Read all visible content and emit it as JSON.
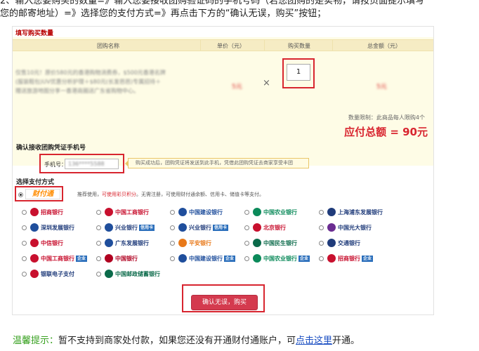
{
  "intro": {
    "line1": "2、输入您要购买的数量=》输入您要接收团购验证码的手机号码（若您团购的是实物，请按页面提示填写",
    "line2": "您的邮寄地址）=》选择您的支付方式=》再点击下方的“确认无误，购买”按钮；"
  },
  "order": {
    "section_title": "填写购买数量",
    "columns": [
      "团购名称",
      "单价（元）",
      "购买数量",
      "总金额（元）"
    ],
    "product_desc": "仅售10元！原价580元的香港购物消费券，$500元香港名牌(服装鞋包)UV优惠分析护理＋$80元(长发芭芭)专属招待＋赠送旅游地图分享一香港商圈送广东省购物中心。",
    "unit_price": "5元",
    "times_sign": "×",
    "quantity": "1",
    "line_total": "5元",
    "limit_text": "数量限制：此商品每人限购4个",
    "total_text": "应付总额 = 90元"
  },
  "phone": {
    "title": "确认接收团购凭证手机号",
    "label": "手机号：",
    "masked_value": "136****5588",
    "tip": "购买成功后，团购凭证将发送到此手机，凭借此团购凭证去商家享受丰团"
  },
  "payment": {
    "title": "选择支付方式",
    "tenpay_logo": "财付通",
    "tenpay_note_pre": "推荐使用，",
    "tenpay_note_red": "可使用彩贝积分",
    "tenpay_note_post": "。无需注册，可使用财付通余额、信用卡、储值卡等支付。",
    "banks": [
      {
        "name": "招商银行",
        "color": "#c8102e",
        "logo_color": "#c8102e",
        "badge": ""
      },
      {
        "name": "中国工商银行",
        "color": "#c8102e",
        "logo_color": "#c8102e",
        "badge": ""
      },
      {
        "name": "中国建设银行",
        "color": "#1f4e9c",
        "logo_color": "#1f4e9c",
        "badge": ""
      },
      {
        "name": "中国农业银行",
        "color": "#0b8a5a",
        "logo_color": "#0b8a5a",
        "badge": ""
      },
      {
        "name": "上海浦东发展银行",
        "color": "#1f3b7a",
        "logo_color": "#1f3b7a",
        "badge": ""
      },
      {
        "name": "深圳发展银行",
        "color": "#1f3b7a",
        "logo_color": "#1f4e9c",
        "badge": ""
      },
      {
        "name": "兴业银行",
        "color": "#1f3b7a",
        "logo_color": "#1f4e9c",
        "badge": "信用卡"
      },
      {
        "name": "兴业银行",
        "color": "#1f3b7a",
        "logo_color": "#1f4e9c",
        "badge": "信用卡"
      },
      {
        "name": "北京银行",
        "color": "#c8102e",
        "logo_color": "#c8102e",
        "badge": ""
      },
      {
        "name": "中国光大银行",
        "color": "#1f3b7a",
        "logo_color": "#6a2c91",
        "badge": ""
      },
      {
        "name": "中信银行",
        "color": "#c8102e",
        "logo_color": "#c8102e",
        "badge": ""
      },
      {
        "name": "广东发展银行",
        "color": "#1f3b7a",
        "logo_color": "#1f4e9c",
        "badge": ""
      },
      {
        "name": "平安银行",
        "color": "#e8791a",
        "logo_color": "#e8791a",
        "badge": ""
      },
      {
        "name": "中国民生银行",
        "color": "#0b6a4a",
        "logo_color": "#0b6a4a",
        "badge": ""
      },
      {
        "name": "交通银行",
        "color": "#1f3b7a",
        "logo_color": "#1f3b7a",
        "badge": ""
      },
      {
        "name": "中国工商银行",
        "color": "#c8102e",
        "logo_color": "#c8102e",
        "badge": "企业"
      },
      {
        "name": "中国银行",
        "color": "#b00020",
        "logo_color": "#b00020",
        "badge": ""
      },
      {
        "name": "中国建设银行",
        "color": "#1f4e9c",
        "logo_color": "#1f4e9c",
        "badge": "企业"
      },
      {
        "name": "中国农业银行",
        "color": "#0b8a5a",
        "logo_color": "#0b8a5a",
        "badge": "企业"
      },
      {
        "name": "招商银行",
        "color": "#c8102e",
        "logo_color": "#c8102e",
        "badge": "企业"
      },
      {
        "name": "银联电子支付",
        "color": "#1f3b7a",
        "logo_color": "#c8102e",
        "badge": ""
      },
      {
        "name": "中国邮政储蓄银行",
        "color": "#0b6a4a",
        "logo_color": "#0b6a4a",
        "badge": ""
      }
    ]
  },
  "confirm_label": "确认无误，购买",
  "footer": {
    "warm": "温馨提示：",
    "text": "暂不支持到商家处付款，如果您还没有开通财付通账户，可",
    "link": "点击这里",
    "tail": "开通。"
  }
}
